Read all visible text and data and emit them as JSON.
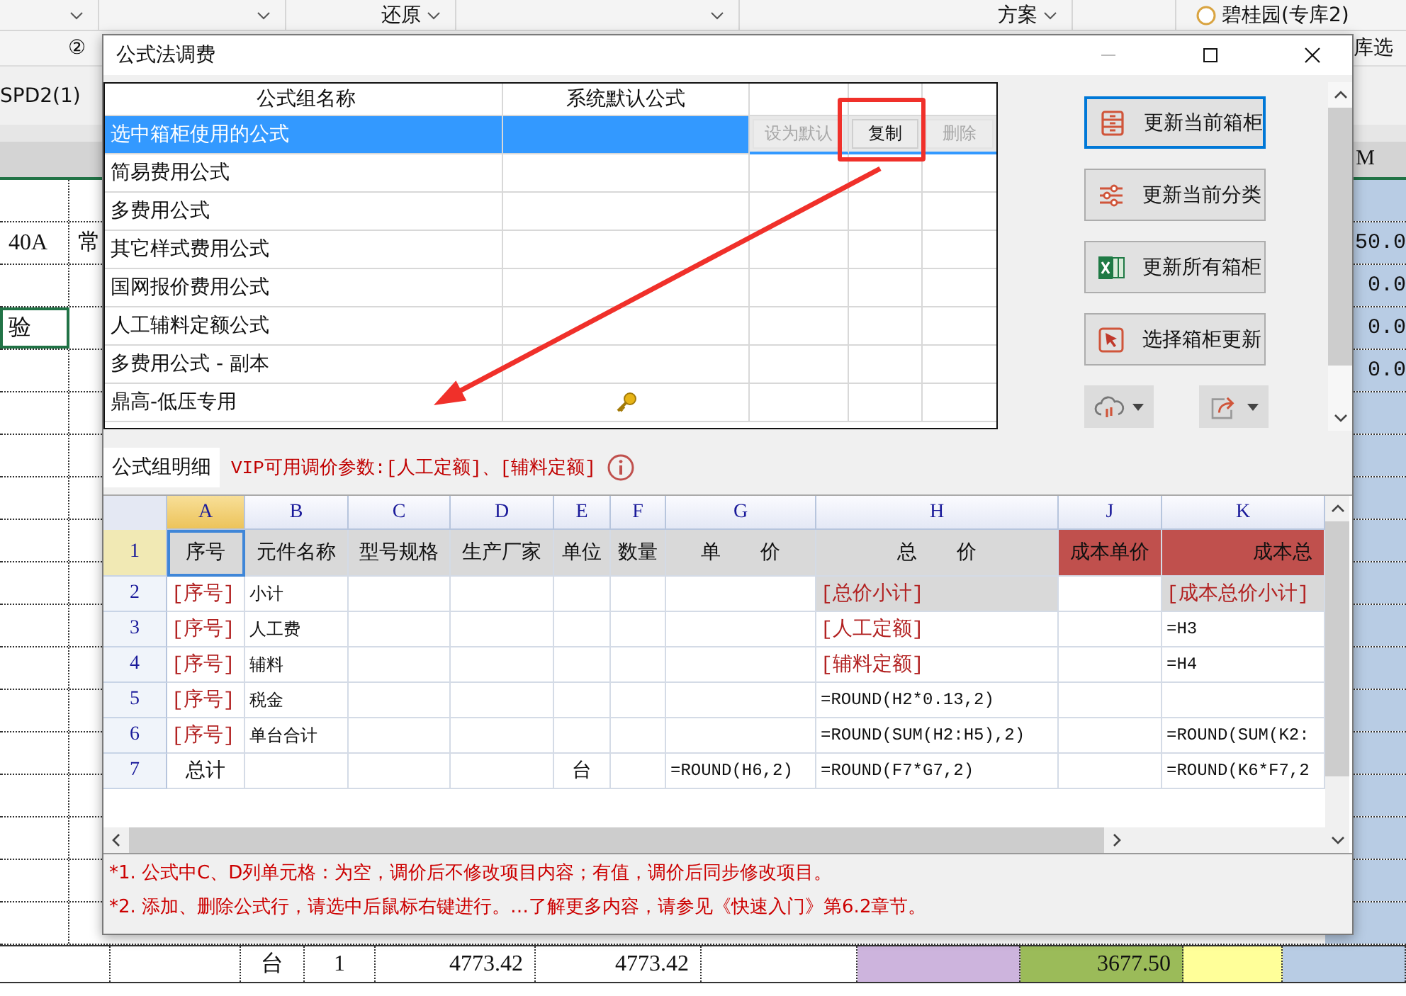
{
  "background": {
    "toolbar": [
      "还原",
      "方案",
      "碧桂园(专库2)"
    ],
    "step_label": "②",
    "side_label": "库选",
    "sheet_tab": "SPD2(1)",
    "left_cells": [
      {
        "text": "40A"
      },
      {
        "text": "常"
      },
      {
        "text": "验",
        "selected": true
      }
    ],
    "right_header": "M",
    "right_values": [
      "50.0",
      "0.0",
      "0.0",
      "0.0"
    ],
    "bottom_row": [
      "台",
      "1",
      "4773.42",
      "4773.42",
      "3677.50"
    ]
  },
  "dialog": {
    "title": "公式法调费",
    "groups": {
      "columns": [
        "公式组名称",
        "系统默认公式"
      ],
      "actions": [
        {
          "label": "设为默认",
          "disabled": true
        },
        {
          "label": "复制",
          "disabled": false
        },
        {
          "label": "删除",
          "disabled": true
        }
      ],
      "rows": [
        {
          "name": "选中箱柜使用的公式",
          "selected": true,
          "key": false
        },
        {
          "name": "简易费用公式",
          "selected": false,
          "key": false
        },
        {
          "name": "多费用公式",
          "selected": false,
          "key": false
        },
        {
          "name": "其它样式费用公式",
          "selected": false,
          "key": false
        },
        {
          "name": "国网报价费用公式",
          "selected": false,
          "key": false
        },
        {
          "name": "人工辅料定额公式",
          "selected": false,
          "key": false
        },
        {
          "name": "多费用公式 - 副本",
          "selected": false,
          "key": false
        },
        {
          "name": "鼎高-低压专用",
          "selected": false,
          "key": true
        }
      ]
    },
    "side_buttons": [
      {
        "label": "更新当前箱柜",
        "kind": "cabinet",
        "focused": true
      },
      {
        "label": "更新当前分类",
        "kind": "sliders",
        "focused": false
      },
      {
        "label": "更新所有箱柜",
        "kind": "excel",
        "focused": false
      },
      {
        "label": "选择箱柜更新",
        "kind": "cursor",
        "focused": false
      }
    ],
    "tool_buttons": [
      {
        "kind": "cloud"
      },
      {
        "kind": "share"
      }
    ],
    "detail_tab": "公式组明细",
    "vip_note": "VIP可用调价参数:[人工定额]、[辅料定额]",
    "sheet": {
      "columns": [
        {
          "label": "A",
          "selected": true
        },
        {
          "label": "B",
          "selected": false
        },
        {
          "label": "C",
          "selected": false
        },
        {
          "label": "D",
          "selected": false
        },
        {
          "label": "E",
          "selected": false
        },
        {
          "label": "F",
          "selected": false
        },
        {
          "label": "G",
          "selected": false
        },
        {
          "label": "H",
          "selected": false
        },
        {
          "label": "J",
          "selected": false
        },
        {
          "label": "K",
          "selected": false
        }
      ],
      "rows": [
        {
          "number": "1",
          "selected": true,
          "cells": [
            {
              "text": "序号",
              "kind": "header"
            },
            {
              "text": "元件名称",
              "kind": "header"
            },
            {
              "text": "型号规格",
              "kind": "header"
            },
            {
              "text": "生产厂家",
              "kind": "header"
            },
            {
              "text": "单位",
              "kind": "header"
            },
            {
              "text": "数量",
              "kind": "header"
            },
            {
              "text": "单　　价",
              "kind": "header"
            },
            {
              "text": "总　　价",
              "kind": "header"
            },
            {
              "text": "成本单价",
              "kind": "cost-header"
            },
            {
              "text": "成本总",
              "kind": "cost-header-end"
            }
          ]
        },
        {
          "number": "2",
          "selected": false,
          "cells": [
            {
              "text": "[序号]",
              "kind": "param"
            },
            {
              "text": "小计",
              "kind": "plain"
            },
            {
              "kind": "plain"
            },
            {
              "kind": "plain"
            },
            {
              "kind": "plain"
            },
            {
              "kind": "plain"
            },
            {
              "kind": "plain"
            },
            {
              "text": "[总价小计]",
              "kind": "subtotal"
            },
            {
              "kind": "plain"
            },
            {
              "text": "[成本总价小计]",
              "kind": "subtotal"
            }
          ]
        },
        {
          "number": "3",
          "selected": false,
          "cells": [
            {
              "text": "[序号]",
              "kind": "param"
            },
            {
              "text": "人工费",
              "kind": "plain"
            },
            {
              "kind": "plain"
            },
            {
              "kind": "plain"
            },
            {
              "kind": "plain"
            },
            {
              "kind": "plain"
            },
            {
              "kind": "plain"
            },
            {
              "text": "[人工定额]",
              "kind": "param"
            },
            {
              "kind": "plain"
            },
            {
              "text": "=H3",
              "kind": "plain"
            }
          ]
        },
        {
          "number": "4",
          "selected": false,
          "cells": [
            {
              "text": "[序号]",
              "kind": "param"
            },
            {
              "text": "辅料",
              "kind": "plain"
            },
            {
              "kind": "plain"
            },
            {
              "kind": "plain"
            },
            {
              "kind": "plain"
            },
            {
              "kind": "plain"
            },
            {
              "kind": "plain"
            },
            {
              "text": "[辅料定额]",
              "kind": "param"
            },
            {
              "kind": "plain"
            },
            {
              "text": "=H4",
              "kind": "plain"
            }
          ]
        },
        {
          "number": "5",
          "selected": false,
          "cells": [
            {
              "text": "[序号]",
              "kind": "param"
            },
            {
              "text": "税金",
              "kind": "plain"
            },
            {
              "kind": "plain"
            },
            {
              "kind": "plain"
            },
            {
              "kind": "plain"
            },
            {
              "kind": "plain"
            },
            {
              "kind": "plain"
            },
            {
              "text": "=ROUND(H2*0.13,2)",
              "kind": "plain"
            },
            {
              "kind": "plain"
            },
            {
              "kind": "plain"
            }
          ]
        },
        {
          "number": "6",
          "selected": false,
          "cells": [
            {
              "text": "[序号]",
              "kind": "param"
            },
            {
              "text": "单台合计",
              "kind": "plain"
            },
            {
              "kind": "plain"
            },
            {
              "kind": "plain"
            },
            {
              "kind": "plain"
            },
            {
              "kind": "plain"
            },
            {
              "kind": "plain"
            },
            {
              "text": "=ROUND(SUM(H2:H5),2)",
              "kind": "plain"
            },
            {
              "kind": "plain"
            },
            {
              "text": "=ROUND(SUM(K2:",
              "kind": "plain"
            }
          ]
        },
        {
          "number": "7",
          "selected": false,
          "cells": [
            {
              "text": "总计",
              "kind": "center"
            },
            {
              "kind": "plain"
            },
            {
              "kind": "plain"
            },
            {
              "kind": "plain"
            },
            {
              "text": "台",
              "kind": "center"
            },
            {
              "kind": "plain"
            },
            {
              "text": "=ROUND(H6,2)",
              "kind": "plain"
            },
            {
              "text": "=ROUND(F7*G7,2)",
              "kind": "plain"
            },
            {
              "kind": "plain"
            },
            {
              "text": "=ROUND(K6*F7,2",
              "kind": "plain"
            }
          ]
        }
      ]
    },
    "notes": [
      "*1. 公式中C、D列单元格：为空，调价后不修改项目内容；有值，调价后同步修改项目。",
      "*2. 添加、删除公式行，请选中后鼠标右键进行。…了解更多内容，请参见《快速入门》第6.2章节。"
    ]
  }
}
